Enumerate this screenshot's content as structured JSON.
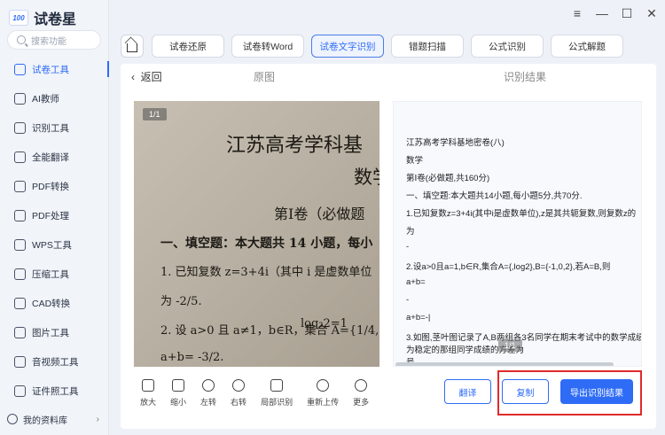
{
  "app": {
    "logo_badge": "100",
    "title": "试卷星"
  },
  "search": {
    "placeholder": "搜索功能"
  },
  "sidebar": {
    "items": [
      {
        "label": "试卷工具",
        "icon": "layers-icon",
        "active": true
      },
      {
        "label": "AI教师",
        "icon": "teacher-icon"
      },
      {
        "label": "识别工具",
        "icon": "scan-icon"
      },
      {
        "label": "全能翻译",
        "icon": "translate-icon"
      },
      {
        "label": "PDF转换",
        "icon": "pdf-convert-icon"
      },
      {
        "label": "PDF处理",
        "icon": "pdf-process-icon"
      },
      {
        "label": "WPS工具",
        "icon": "wps-icon"
      },
      {
        "label": "压缩工具",
        "icon": "compress-icon"
      },
      {
        "label": "CAD转换",
        "icon": "cad-icon"
      },
      {
        "label": "图片工具",
        "icon": "image-icon"
      },
      {
        "label": "音视频工具",
        "icon": "media-icon"
      },
      {
        "label": "证件照工具",
        "icon": "id-photo-icon"
      }
    ],
    "library": "我的资料库"
  },
  "tabs": [
    {
      "label": "试卷还原",
      "active": false
    },
    {
      "label": "试卷转Word",
      "active": false
    },
    {
      "label": "试卷文字识别",
      "active": true
    },
    {
      "label": "错题扫描",
      "active": false
    },
    {
      "label": "公式识别",
      "active": false
    },
    {
      "label": "公式解题",
      "active": false
    }
  ],
  "header": {
    "back": "返回",
    "original": "原图",
    "result": "识别结果"
  },
  "image": {
    "page": "1/1",
    "lines": [
      "江苏高考学科基",
      "数学",
      "第Ⅰ卷（必做题",
      "一、填空题：本大题共 14 小题，每小",
      "1. 已知复数 z=3+4i（其中 i 是虚数单位",
      "为 -2/5.",
      "2. 设 a>0 且 a≠1，b∈R，集合 A={1/4,",
      "log₂2=1",
      "a+b= -3/2."
    ]
  },
  "tools": [
    {
      "label": "放大",
      "icon": "zoom-in-icon"
    },
    {
      "label": "缩小",
      "icon": "zoom-out-icon"
    },
    {
      "label": "左转",
      "icon": "rotate-left-icon"
    },
    {
      "label": "右转",
      "icon": "rotate-right-icon"
    },
    {
      "label": "局部识别",
      "icon": "crop-icon"
    },
    {
      "label": "重新上传",
      "icon": "reupload-icon"
    },
    {
      "label": "更多",
      "icon": "more-icon"
    }
  ],
  "result": {
    "lines": [
      "江苏高考学科基地密卷(八)",
      "数学",
      "第Ⅰ卷(必做题,共160分)",
      "一、填空题:本大题共14小题,每小题5分,共70分.",
      "1.已知复数z=3+4i(其中i是虚数单位),z是其共轭复数,则复数z的",
      "为",
      "-",
      "2.设a>0且a=1,b∈R,集合A={,log2},B={-1,0,2},若A=B,则",
      "a+b=",
      "-",
      "a+b=-|",
      "3.如图,茎叶图记录了A,B两组各3名同学在期末考试中的数学成绩",
      "为稳定的那组同学成绩的方差为",
      "号"
    ],
    "page": "1/1"
  },
  "buttons": {
    "translate": "翻译",
    "copy": "复制",
    "export": "导出识别结果"
  }
}
